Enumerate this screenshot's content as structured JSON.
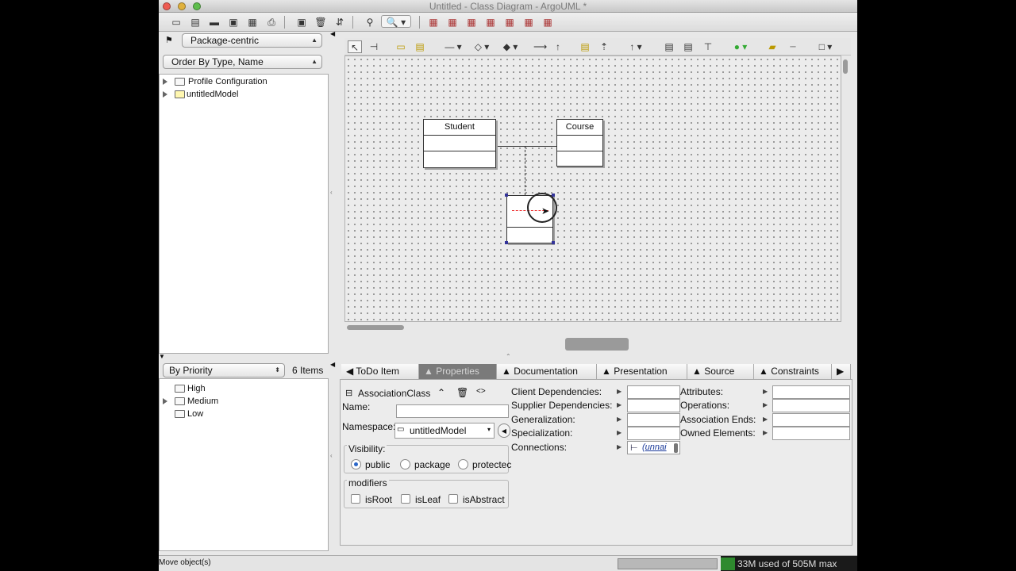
{
  "window": {
    "title": "Untitled - Class Diagram - ArgoUML *"
  },
  "explorer": {
    "perspective": "Package-centric",
    "order": "Order By Type, Name",
    "tree": [
      "Profile Configuration",
      "untitledModel"
    ]
  },
  "diagram": {
    "classes": [
      {
        "name": "Student"
      },
      {
        "name": "Course"
      }
    ]
  },
  "todo": {
    "grouping": "By Priority",
    "count": "6 Items",
    "items": [
      "High",
      "Medium",
      "Low"
    ]
  },
  "tabs": [
    "ToDo Item",
    "Properties",
    "Documentation",
    "Presentation",
    "Source",
    "Constraints"
  ],
  "properties": {
    "element_type": "AssociationClass",
    "name_label": "Name:",
    "name_value": "",
    "namespace_label": "Namespace:",
    "namespace_value": "untitledModel",
    "visibility_label": "Visibility:",
    "visibility_options": [
      "public",
      "package",
      "protectec"
    ],
    "modifiers_label": "modifiers",
    "modifiers": [
      "isRoot",
      "isLeaf",
      "isAbstract"
    ],
    "mid_labels": [
      "Client Dependencies:",
      "Supplier Dependencies:",
      "Generalization:",
      "Specialization:",
      "Connections:"
    ],
    "connection_value": "(unnai",
    "right_labels": [
      "Attributes:",
      "Operations:",
      "Association Ends:",
      "Owned Elements:"
    ]
  },
  "status": {
    "message": "Move object(s)",
    "memory": "33M used of 505M max"
  }
}
